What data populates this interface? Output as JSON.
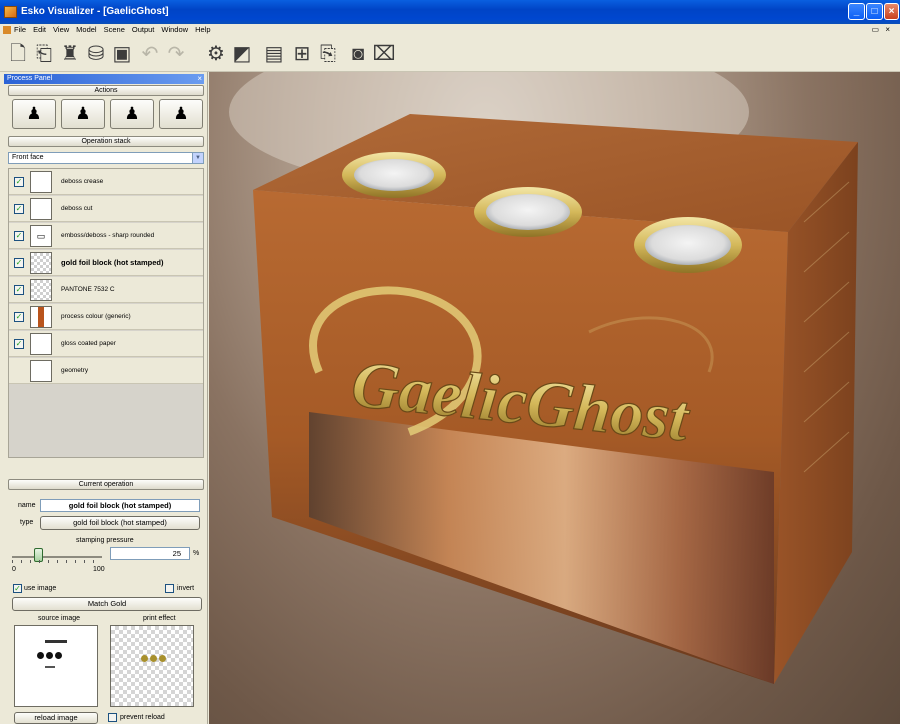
{
  "window": {
    "title": "Esko Visualizer - [GaelicGhost]",
    "minimize": "_",
    "maximize": "□",
    "close": "×"
  },
  "menu": {
    "items": [
      "File",
      "Edit",
      "View",
      "Model",
      "Scene",
      "Output",
      "Window",
      "Help"
    ],
    "mdi_controls": "▭ ×"
  },
  "toolbar": {
    "icons": [
      "new-document-icon",
      "open-icon",
      "model-icon",
      "scene-icon",
      "save-icon",
      "undo-icon",
      "redo-icon",
      "render-icon",
      "screenshot-icon",
      "layers-icon",
      "book-icon",
      "select-icon",
      "camera-icon",
      "movie-icon"
    ]
  },
  "panel": {
    "title": "Process Panel",
    "close": "×",
    "actions_header": "Actions",
    "operation_stack_header": "Operation stack",
    "face_selector": "Front face",
    "operations": [
      {
        "label": "deboss crease",
        "checked": true
      },
      {
        "label": "deboss cut",
        "checked": true
      },
      {
        "label": "emboss/deboss - sharp rounded",
        "checked": true
      },
      {
        "label": "gold foil block (hot stamped)",
        "checked": true,
        "selected": true
      },
      {
        "label": "PANTONE 7532 C",
        "checked": true
      },
      {
        "label": "process colour (generic)",
        "checked": true
      },
      {
        "label": "gloss coated paper",
        "checked": true
      },
      {
        "label": "geometry",
        "checked": false
      }
    ],
    "current_operation_header": "Current operation",
    "name_label": "name",
    "name_value": "gold foil block (hot stamped)",
    "type_label": "type",
    "type_value": "gold foil block (hot stamped)",
    "stamping_pressure_label": "stamping pressure",
    "stamping_pressure_value": "25",
    "stamping_pressure_unit": "%",
    "slider_min": "0",
    "slider_max": "100",
    "slider_level_percent": 25,
    "use_image_label": "use image",
    "use_image_checked": true,
    "invert_label": "invert",
    "invert_checked": false,
    "match_button": "Match Gold",
    "source_image_label": "source image",
    "print_effect_label": "print effect",
    "reload_button": "reload image",
    "prevent_reload_label": "prevent reload",
    "prevent_reload_checked": false
  },
  "viewport": {
    "brand_text": "GaelicGhost",
    "colors": {
      "box_front": "#a55a26",
      "box_top": "#b46a34",
      "box_side": "#8f4d22",
      "gold": "#d9c46a"
    }
  }
}
